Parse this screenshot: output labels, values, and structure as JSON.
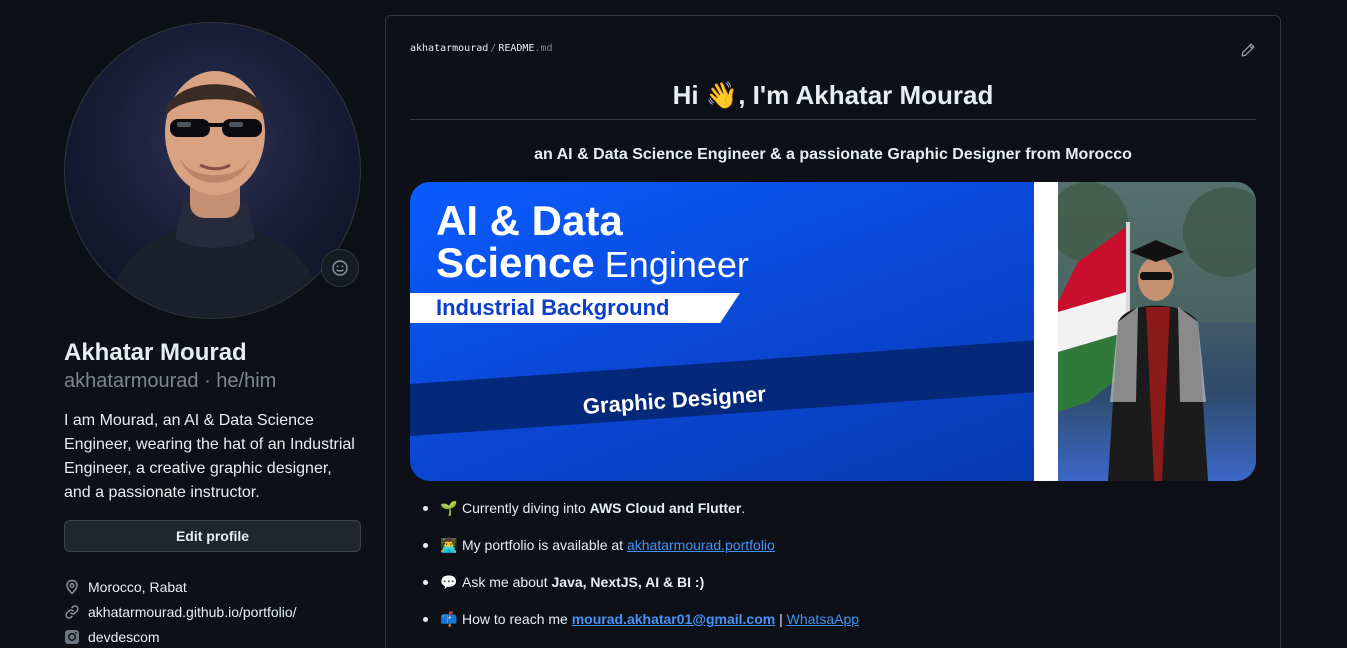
{
  "profile": {
    "fullname": "Akhatar Mourad",
    "username_line": "akhatarmourad · he/him",
    "bio": "I am Mourad, an AI & Data Science Engineer, wearing the hat of an Industrial Engineer, a creative graphic designer, and a passionate instructor.",
    "edit_button": "Edit profile",
    "location": "Morocco, Rabat",
    "website": "akhatarmourad.github.io/portfolio/",
    "social": "devdescom"
  },
  "readme": {
    "breadcrumb_user": "akhatarmourad",
    "breadcrumb_sep": "/",
    "breadcrumb_file": "README",
    "breadcrumb_ext": ".md",
    "heading": "Hi 👋, I'm Akhatar Mourad",
    "tagline": "an AI & Data Science Engineer & a passionate Graphic Designer from Morocco",
    "banner": {
      "line1": "AI & Data",
      "line2_bold": "Science",
      "line2_light": " Engineer",
      "ribbon": "Industrial Background",
      "stripe": "Graphic Designer"
    },
    "items": [
      {
        "emoji": "🌱",
        "pre": "Currently diving into ",
        "bold": "AWS Cloud and Flutter",
        "post": "."
      },
      {
        "emoji": "👨‍💻",
        "pre": "My portfolio is available at ",
        "link": "akhatarmourad.portfolio"
      },
      {
        "emoji": "💬",
        "pre": "Ask me about ",
        "bold": "Java, NextJS, AI & BI :)"
      },
      {
        "emoji": "📫",
        "pre": "How to reach me ",
        "link": "mourad.akhatar01@gmail.com",
        "sep": " | ",
        "link2": "WhatsaApp"
      }
    ]
  },
  "icons": {
    "smiley": "smiley-icon",
    "location": "location-icon",
    "link": "link-icon",
    "social": "instagram-icon",
    "edit": "pencil-icon"
  },
  "colors": {
    "background": "#0d1117",
    "border": "#30363d",
    "link": "#4493f8",
    "banner_blue": "#0a5cff"
  }
}
